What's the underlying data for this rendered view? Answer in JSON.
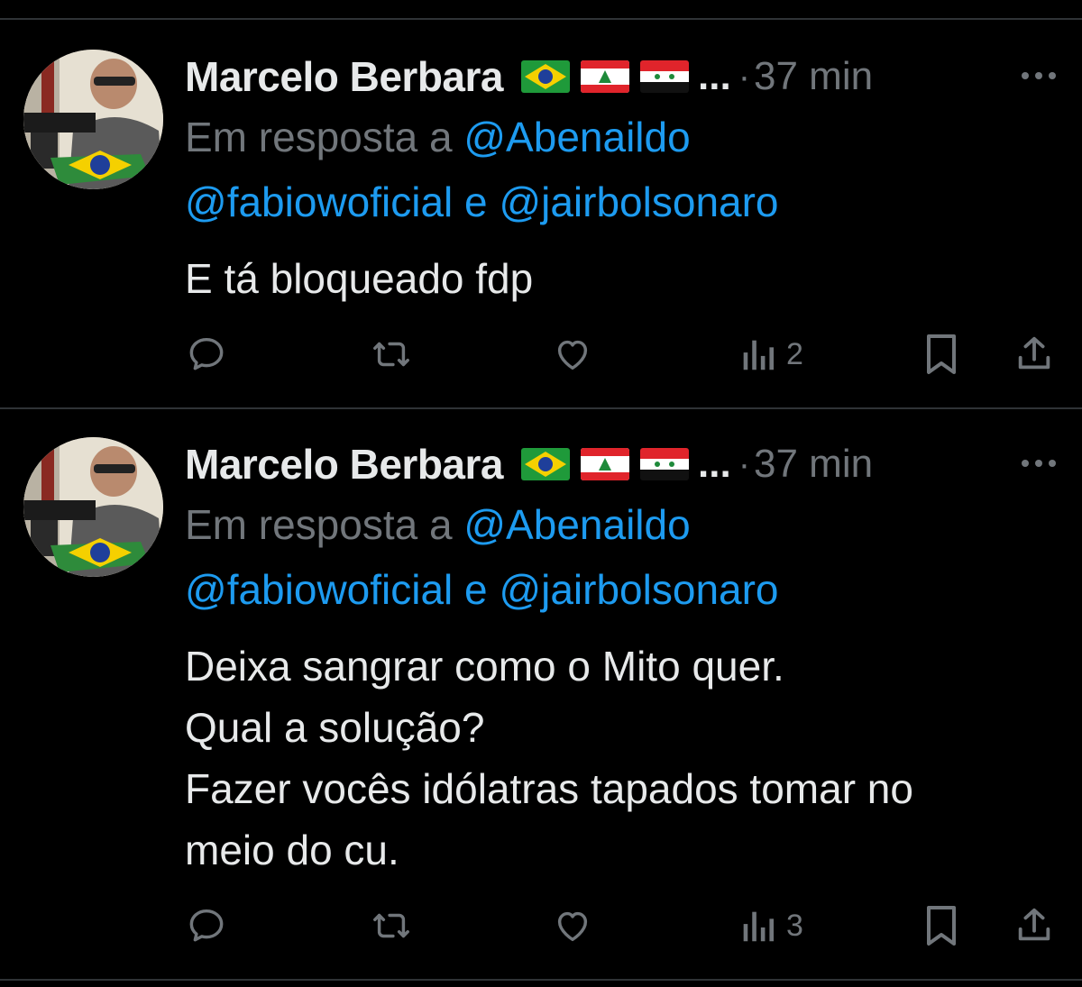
{
  "tweets": [
    {
      "author": "Marcelo Berbara",
      "flags": [
        "brazil-flag",
        "lebanon-flag",
        "syria-flag"
      ],
      "ellipsis": "...",
      "separator": "·",
      "time": "37 min",
      "reply_prefix": "Em resposta a ",
      "mentions": [
        "@Abenaildo",
        "@fabiowoficial",
        "@jairbolsonaro"
      ],
      "mention_joiner": " e ",
      "body_lines": [
        "E tá bloqueado fdp"
      ],
      "views": "2"
    },
    {
      "author": "Marcelo Berbara",
      "flags": [
        "brazil-flag",
        "lebanon-flag",
        "syria-flag"
      ],
      "ellipsis": "...",
      "separator": "·",
      "time": "37 min",
      "reply_prefix": "Em resposta a ",
      "mentions": [
        "@Abenaildo",
        "@fabiowoficial",
        "@jairbolsonaro"
      ],
      "mention_joiner": " e ",
      "body_lines": [
        "Deixa sangrar como o Mito quer.",
        "Qual a solução?",
        "Fazer vocês idólatras tapados tomar no",
        "meio do cu."
      ],
      "views": "3"
    }
  ],
  "colors": {
    "background": "#000000",
    "text": "#e7e9ea",
    "muted": "#71767b",
    "link": "#1d9bf0",
    "divider": "#2f3336"
  },
  "icons": [
    "reply-icon",
    "retweet-icon",
    "like-icon",
    "views-icon",
    "bookmark-icon",
    "share-icon",
    "more-icon"
  ]
}
